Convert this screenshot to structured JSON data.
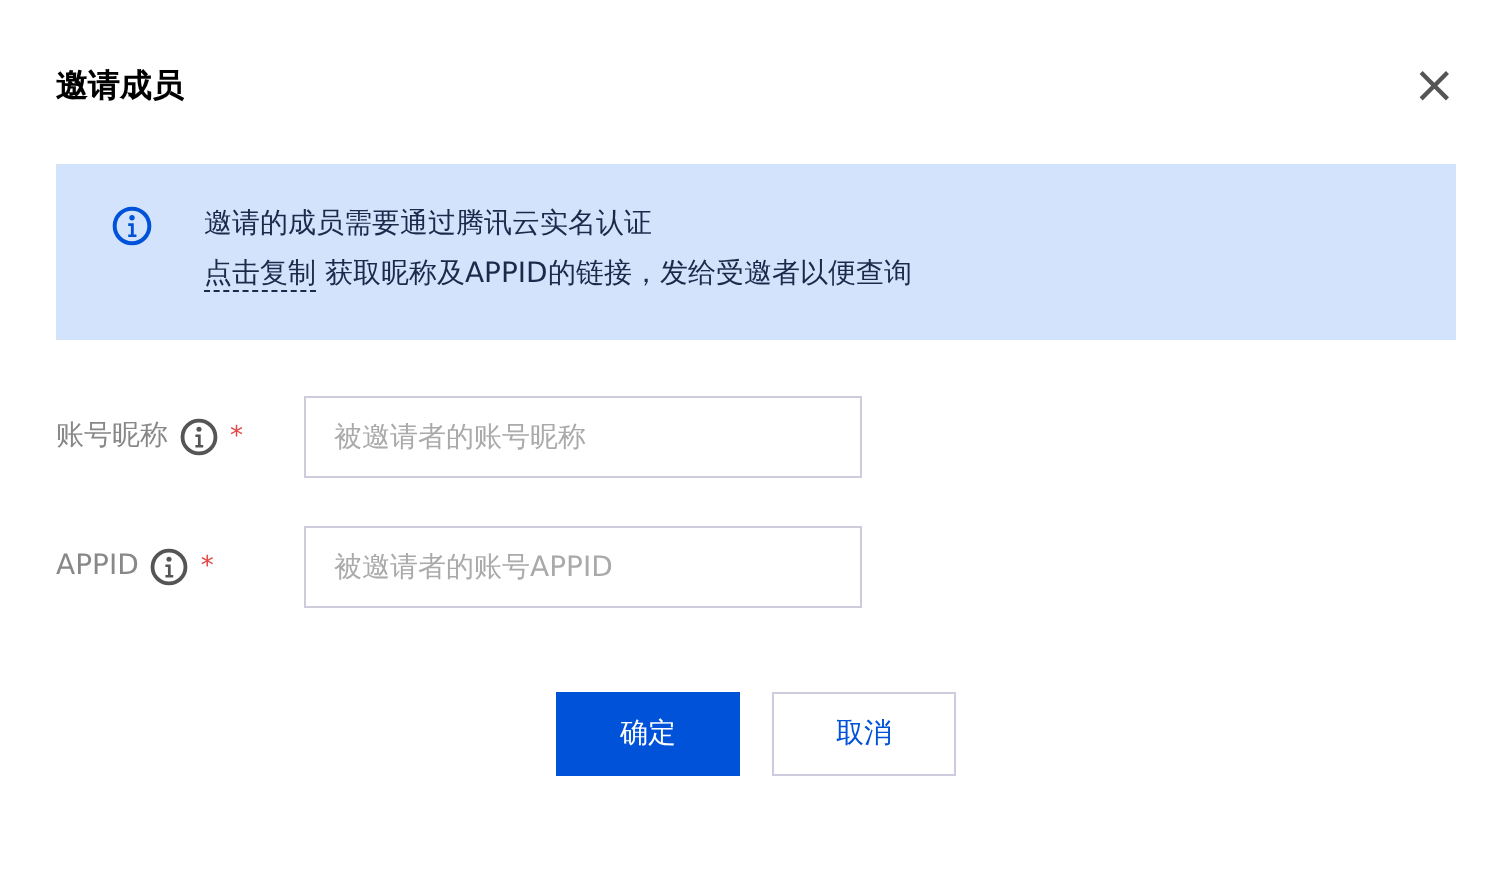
{
  "dialog": {
    "title": "邀请成员",
    "close": "×"
  },
  "notice": {
    "line_1": "邀请的成员需要通过腾讯云实名认证",
    "link": "点击复制",
    "line_2": " 获取昵称及APPID的链接，发给受邀者以便查询"
  },
  "fields": [
    {
      "label": "账号昵称",
      "required_mark": "*",
      "placeholder": "被邀请者的账号昵称"
    },
    {
      "label": "APPID",
      "required_mark": "*",
      "placeholder": "被邀请者的账号APPID"
    }
  ],
  "buttons": [
    {
      "label": "确定",
      "kind": "primary"
    },
    {
      "label": "取消",
      "kind": "secondary"
    }
  ]
}
